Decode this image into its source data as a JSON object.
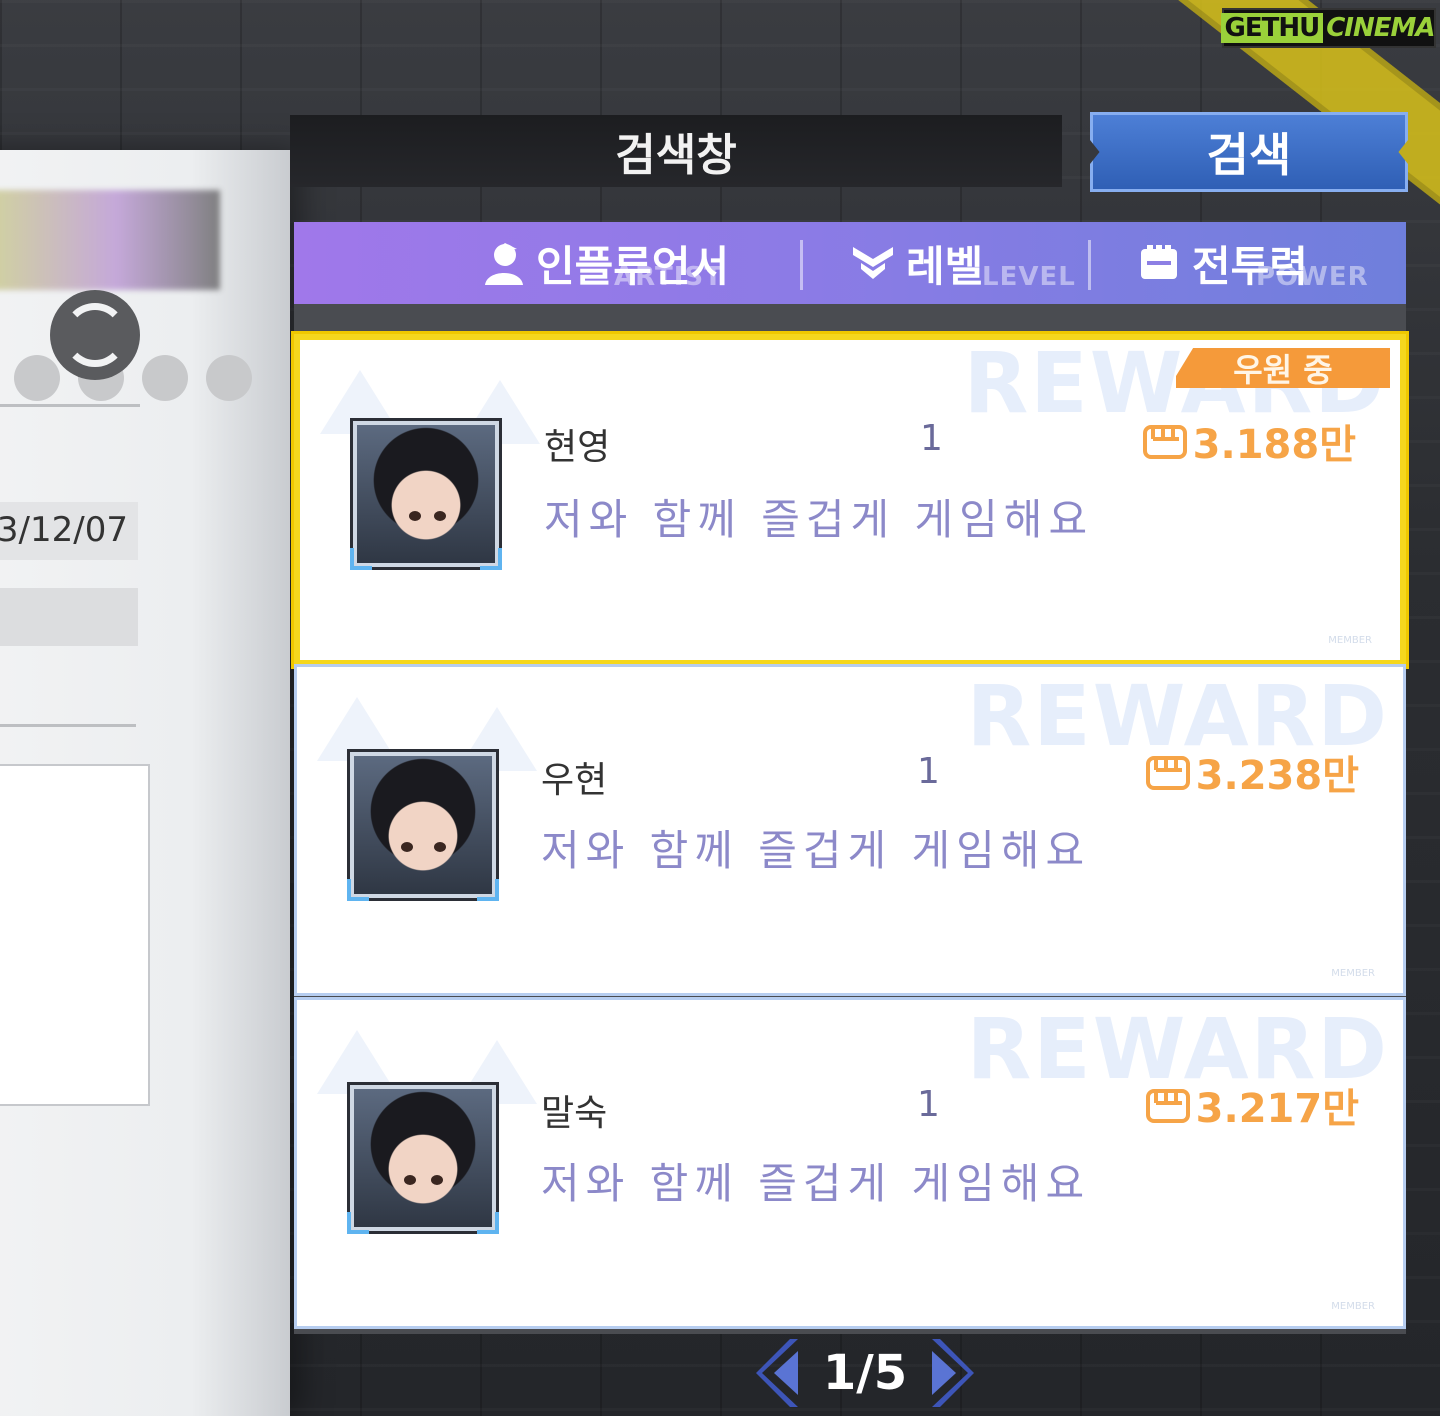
{
  "branding": {
    "logo_part1": "GETHU",
    "logo_part2": "CINEMA"
  },
  "left_panel": {
    "date_value": "3/12/07"
  },
  "search": {
    "field_label": "검색창",
    "button_label": "검색"
  },
  "tabs": [
    {
      "label": "인플루언서",
      "sub_label": "ARTIST",
      "icon": "person-icon"
    },
    {
      "label": "레벨",
      "sub_label": "LEVEL",
      "icon": "level-chevron-icon"
    },
    {
      "label": "전투력",
      "sub_label": "POWER",
      "icon": "fist-icon"
    }
  ],
  "cards": [
    {
      "name": "현영",
      "level": "1",
      "message": "저와 함께 즐겁게 게임해요",
      "power": "3.188만",
      "badge": "우원 중",
      "watermark": "REWARD",
      "footer": "MEMBER",
      "selected": true
    },
    {
      "name": "우현",
      "level": "1",
      "message": "저와 함께 즐겁게 게임해요",
      "power": "3.238만",
      "badge": "",
      "watermark": "REWARD",
      "footer": "MEMBER",
      "selected": false
    },
    {
      "name": "말숙",
      "level": "1",
      "message": "저와 함께 즐겁게 게임해요",
      "power": "3.217만",
      "badge": "",
      "watermark": "REWARD",
      "footer": "MEMBER",
      "selected": false
    }
  ],
  "pagination": {
    "current": "1/5"
  },
  "colors": {
    "accent_purple": "#8c7be6",
    "power_orange": "#f6a447",
    "selected_yellow": "#f5d71e",
    "button_blue": "#3a6cc4"
  }
}
